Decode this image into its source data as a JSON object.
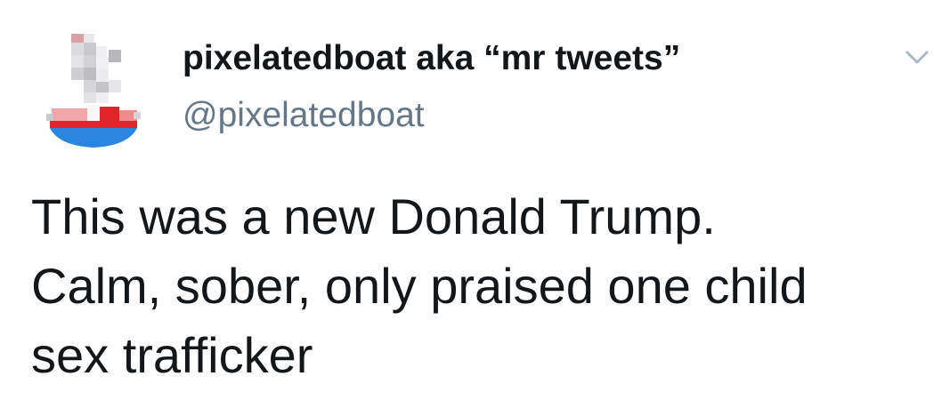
{
  "author": {
    "display_name": "pixelatedboat aka “mr tweets”",
    "handle": "@pixelatedboat",
    "avatar_icon": "pixelated-boat-avatar"
  },
  "menu": {
    "icon": "chevron-down-icon",
    "color": "#aab8c2"
  },
  "tweet": {
    "lines": [
      "This was a new Donald Trump.",
      "Calm, sober, only praised one child",
      "sex trafficker"
    ]
  },
  "colors": {
    "text": "#14171a",
    "secondary": "#657786",
    "hull_blue": "#2b86e0",
    "hull_red": "#e0242a"
  }
}
